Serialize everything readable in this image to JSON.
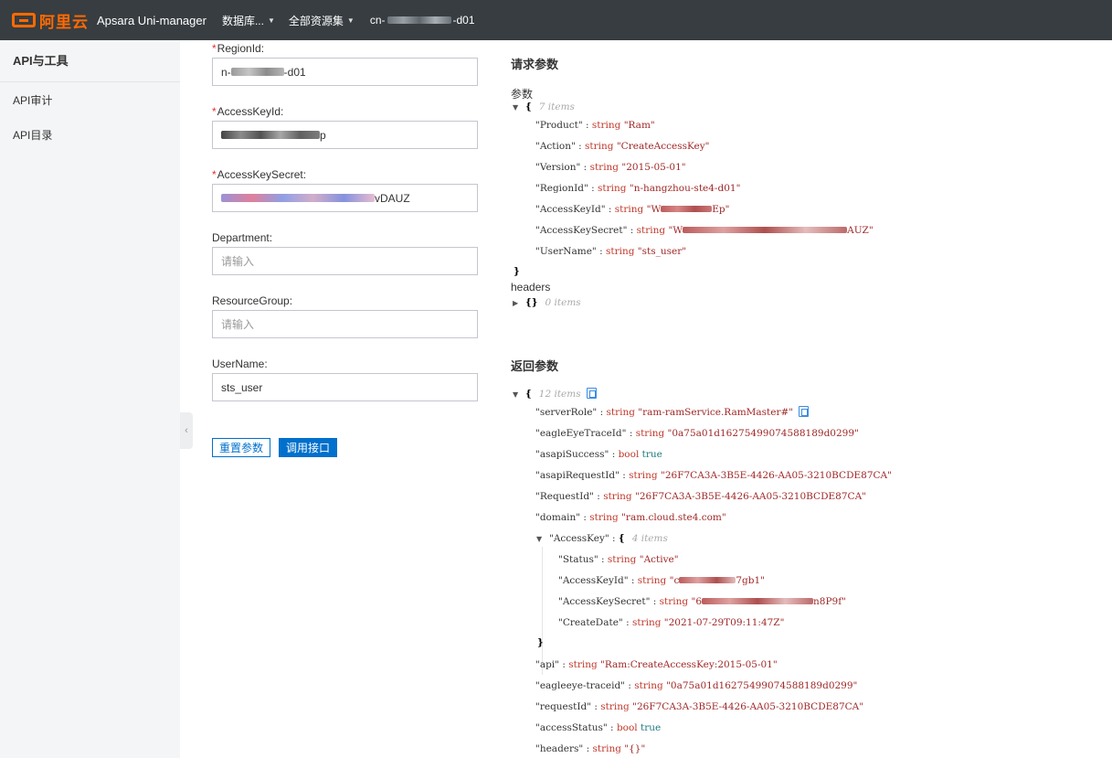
{
  "topbar": {
    "logo_text": "阿里云",
    "product": "Apsara Uni-manager",
    "nav": [
      {
        "label": "数据库..."
      },
      {
        "label": "全部资源集"
      },
      {
        "label_prefix": "cn-",
        "label_suffix": "-d01"
      }
    ]
  },
  "sidebar": {
    "title": "API与工具",
    "items": [
      "API审计",
      "API目录"
    ]
  },
  "form": {
    "fields": [
      {
        "label": "RegionId:",
        "required": true,
        "value_prefix": "n-",
        "value_suffix": "-d01"
      },
      {
        "label": "AccessKeyId:",
        "required": true,
        "value_suffix": "p"
      },
      {
        "label": "AccessKeySecret:",
        "required": true,
        "value_suffix": "vDAUZ"
      },
      {
        "label": "Department:",
        "required": false,
        "placeholder": "请输入"
      },
      {
        "label": "ResourceGroup:",
        "required": false,
        "placeholder": "请输入"
      },
      {
        "label": "UserName:",
        "required": false,
        "value": "sts_user"
      }
    ],
    "reset_label": "重置参数",
    "call_label": "调用接口"
  },
  "request": {
    "title": "请求参数",
    "params_label": "参数",
    "params_count": "7 items",
    "params": [
      {
        "key": "\"Product\"",
        "type": "string",
        "value": "\"Ram\""
      },
      {
        "key": "\"Action\"",
        "type": "string",
        "value": "\"CreateAccessKey\""
      },
      {
        "key": "\"Version\"",
        "type": "string",
        "value": "\"2015-05-01\""
      },
      {
        "key": "\"RegionId\"",
        "type": "string",
        "value": "\"n-hangzhou-ste4-d01\""
      },
      {
        "key": "\"AccessKeyId\"",
        "type": "string",
        "value_prefix": "\"W",
        "value_suffix": "Ep\""
      },
      {
        "key": "\"AccessKeySecret\"",
        "type": "string",
        "value_prefix": "\"W",
        "value_suffix": "AUZ\""
      },
      {
        "key": "\"UserName\"",
        "type": "string",
        "value": "\"sts_user\""
      }
    ],
    "headers_label": "headers",
    "headers_count": "0 items"
  },
  "response": {
    "title": "返回参数",
    "count": "12 items",
    "rows": [
      {
        "key": "\"serverRole\"",
        "type": "string",
        "value": "\"ram-ramService.RamMaster#\"",
        "copy": true
      },
      {
        "key": "\"eagleEyeTraceId\"",
        "type": "string",
        "value": "\"0a75a01d16275499074588189d0299\""
      },
      {
        "key": "\"asapiSuccess\"",
        "type": "bool",
        "value": "true"
      },
      {
        "key": "\"asapiRequestId\"",
        "type": "string",
        "value": "\"26F7CA3A-3B5E-4426-AA05-3210BCDE87CA\""
      },
      {
        "key": "\"RequestId\"",
        "type": "string",
        "value": "\"26F7CA3A-3B5E-4426-AA05-3210BCDE87CA\""
      },
      {
        "key": "\"domain\"",
        "type": "string",
        "value": "\"ram.cloud.ste4.com\""
      }
    ],
    "access_key": {
      "key": "\"AccessKey\"",
      "count": "4 items",
      "rows": [
        {
          "key": "\"Status\"",
          "type": "string",
          "value": "\"Active\""
        },
        {
          "key": "\"AccessKeyId\"",
          "type": "string",
          "value_prefix": "\"c",
          "value_suffix": "7gb1\""
        },
        {
          "key": "\"AccessKeySecret\"",
          "type": "string",
          "value_prefix": "\"6",
          "value_suffix": "n8P9f\""
        },
        {
          "key": "\"CreateDate\"",
          "type": "string",
          "value": "\"2021-07-29T09:11:47Z\""
        }
      ]
    },
    "rows_after": [
      {
        "key": "\"api\"",
        "type": "string",
        "value": "\"Ram:CreateAccessKey:2015-05-01\""
      },
      {
        "key": "\"eagleeye-traceid\"",
        "type": "string",
        "value": "\"0a75a01d16275499074588189d0299\""
      },
      {
        "key": "\"requestId\"",
        "type": "string",
        "value": "\"26F7CA3A-3B5E-4426-AA05-3210BCDE87CA\""
      },
      {
        "key": "\"accessStatus\"",
        "type": "bool",
        "value": "true"
      },
      {
        "key": "\"headers\"",
        "type": "string",
        "value": "\"{}\""
      }
    ]
  },
  "colors": {
    "accent": "#0070cc",
    "topbar": "#373d41",
    "brand": "#ff6a00",
    "required": "#e72e2e"
  }
}
